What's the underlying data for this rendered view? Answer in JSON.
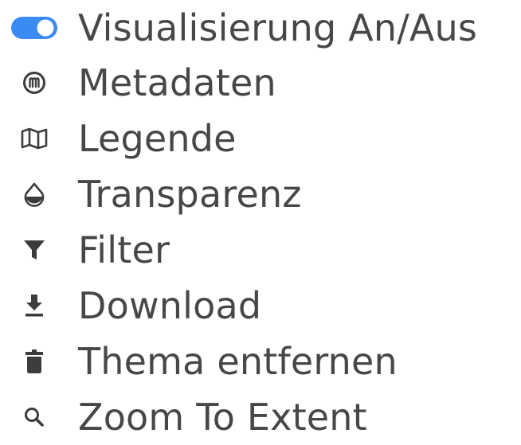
{
  "colors": {
    "text": "#474747",
    "icon": "#3c3c3c",
    "toggle_on": "#3b8bf5"
  },
  "menu": {
    "items": [
      {
        "label": "Visualisierung An/Aus",
        "icon": "toggle-on-icon"
      },
      {
        "label": "Metadaten",
        "icon": "metadata-icon"
      },
      {
        "label": "Legende",
        "icon": "map-icon"
      },
      {
        "label": "Transparenz",
        "icon": "water-drop-icon"
      },
      {
        "label": "Filter",
        "icon": "funnel-icon"
      },
      {
        "label": "Download",
        "icon": "download-icon"
      },
      {
        "label": "Thema entfernen",
        "icon": "trash-icon"
      },
      {
        "label": "Zoom To Extent",
        "icon": "magnifier-icon"
      }
    ]
  }
}
